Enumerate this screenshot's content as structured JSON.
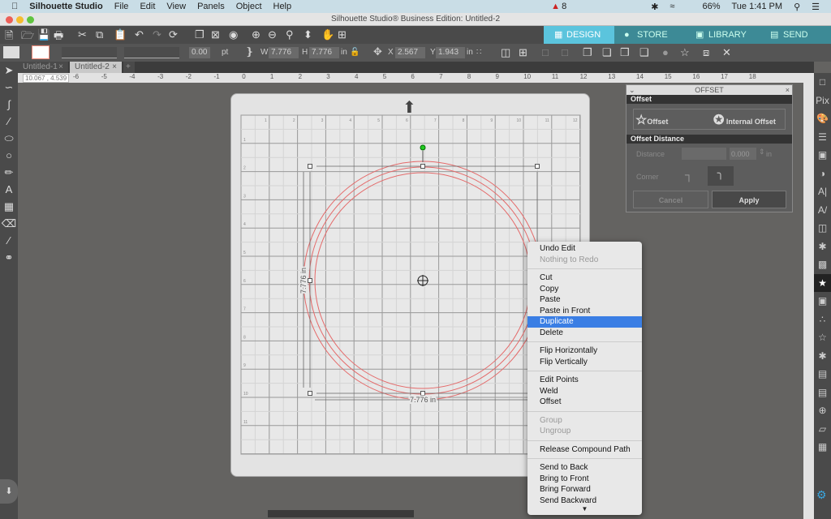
{
  "menubar": {
    "app": "Silhouette Studio",
    "items": [
      "File",
      "Edit",
      "View",
      "Panels",
      "Object",
      "Help"
    ],
    "status": {
      "badge": "8",
      "battery": "66%",
      "clock": "Tue 1:41 PM"
    }
  },
  "window": {
    "title": "Silhouette Studio® Business Edition: Untitled-2"
  },
  "nav": {
    "tabs": [
      {
        "label": "DESIGN",
        "icon": "grid-icon"
      },
      {
        "label": "STORE",
        "icon": "silhouette-s-icon"
      },
      {
        "label": "LIBRARY",
        "icon": "folder-icon"
      },
      {
        "label": "SEND",
        "icon": "cutter-icon"
      }
    ],
    "active": "DESIGN",
    "accent": "#5bc4dd"
  },
  "toolbar2": {
    "line_width": "0.00",
    "line_unit": "pt",
    "w_label": "W",
    "w": "7.776",
    "h_label": "H",
    "h": "7.776",
    "size_unit": "in",
    "x_label": "X",
    "x": "2.567",
    "y_label": "Y",
    "y": "1.943",
    "pos_unit": "in"
  },
  "doc_tabs": [
    "Untitled-1",
    "Untitled-2"
  ],
  "cursor_readout": {
    "x": "10.067",
    "y": "4.539"
  },
  "ruler_labels": [
    "-6",
    "-5",
    "-4",
    "-3",
    "-2",
    "-1",
    "0",
    "1",
    "2",
    "3",
    "4",
    "5",
    "6",
    "7",
    "8",
    "9",
    "10",
    "11",
    "12",
    "13",
    "14",
    "15",
    "16",
    "17",
    "18"
  ],
  "mat": {
    "col_labels": [
      "1",
      "2",
      "3",
      "4",
      "5",
      "6",
      "7",
      "8",
      "9",
      "10",
      "11",
      "12"
    ],
    "row_labels": [
      "1",
      "2",
      "3",
      "4",
      "5",
      "6",
      "7",
      "8",
      "9",
      "10",
      "11"
    ],
    "width_dim": "7.776 in",
    "height_dim": "7.776 in",
    "circle_color": "#e46a6a"
  },
  "offset_panel": {
    "title": "OFFSET",
    "section1": "Offset",
    "offset_btn": "Offset",
    "internal_btn": "Internal Offset",
    "section2": "Offset Distance",
    "distance_label": "Distance",
    "distance_value": "0.000",
    "distance_unit": "in",
    "corner_label": "Corner",
    "cancel": "Cancel",
    "apply": "Apply"
  },
  "context_menu": {
    "groups": [
      [
        {
          "label": "Undo Edit"
        },
        {
          "label": "Nothing to Redo",
          "disabled": true
        }
      ],
      [
        {
          "label": "Cut"
        },
        {
          "label": "Copy"
        },
        {
          "label": "Paste"
        },
        {
          "label": "Paste in Front"
        },
        {
          "label": "Duplicate",
          "highlighted": true
        },
        {
          "label": "Delete"
        }
      ],
      [
        {
          "label": "Flip Horizontally"
        },
        {
          "label": "Flip Vertically"
        }
      ],
      [
        {
          "label": "Edit Points"
        },
        {
          "label": "Weld"
        },
        {
          "label": "Offset"
        }
      ],
      [
        {
          "label": "Group",
          "disabled": true
        },
        {
          "label": "Ungroup",
          "disabled": true
        }
      ],
      [
        {
          "label": "Release Compound Path"
        }
      ],
      [
        {
          "label": "Send to Back"
        },
        {
          "label": "Bring to Front"
        },
        {
          "label": "Bring Forward"
        },
        {
          "label": "Send Backward"
        }
      ]
    ],
    "more_icon": "triangle-down-icon"
  }
}
